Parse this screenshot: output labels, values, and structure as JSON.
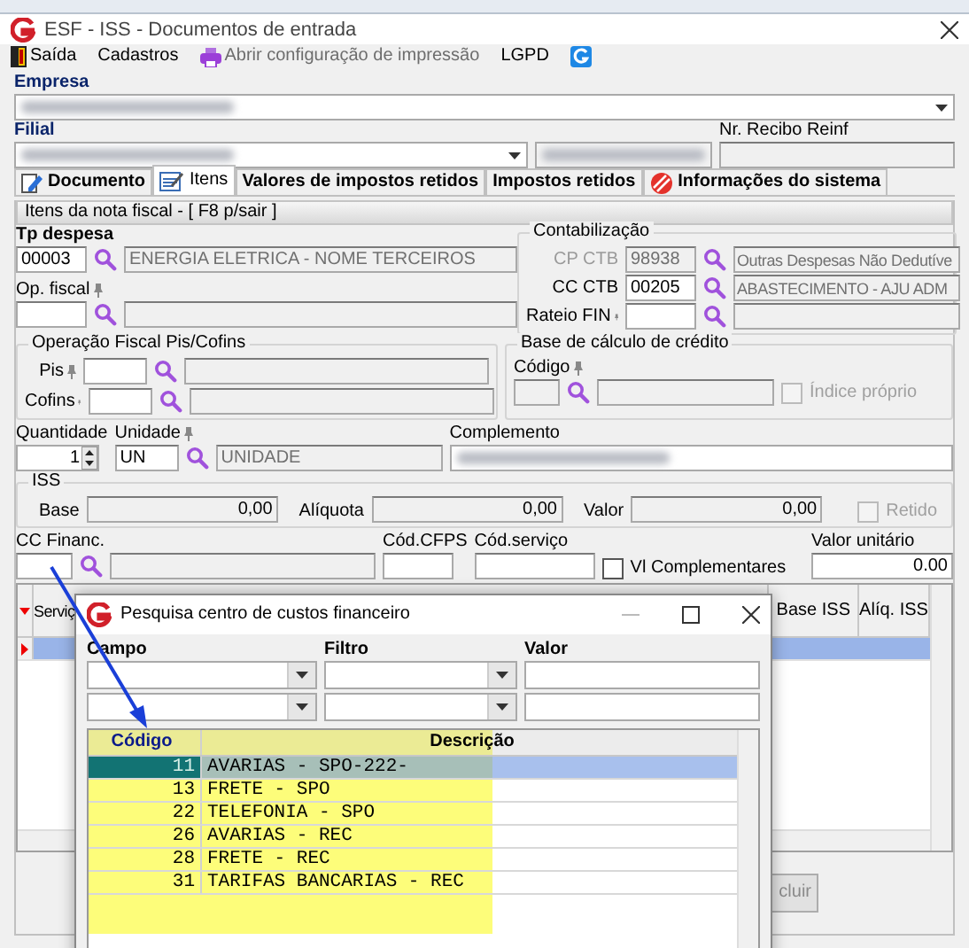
{
  "window": {
    "title": "ESF - ISS - Documentos de entrada"
  },
  "menu": [
    {
      "label": "Saída",
      "disabled": false
    },
    {
      "label": "Cadastros",
      "disabled": false
    },
    {
      "label": "Abrir configuração de impressão",
      "disabled": true
    },
    {
      "label": "LGPD",
      "disabled": false
    },
    {
      "disabled": false
    }
  ],
  "empresa": {
    "label": "Empresa",
    "redacted": true
  },
  "filial": {
    "label": "Filial",
    "redacted": true
  },
  "recibo_reinf": {
    "label": "Nr. Recibo Reinf"
  },
  "tabs": [
    {
      "label": "Documento",
      "selected": false
    },
    {
      "label": "Itens",
      "selected": true
    },
    {
      "label": "Valores de impostos retidos",
      "selected": false
    },
    {
      "label": "Impostos retidos",
      "selected": false
    },
    {
      "label": "Informações do sistema",
      "selected": false
    }
  ],
  "panel_title": "Itens da nota fiscal - [ F8 p/sair ]",
  "tp_despesa": {
    "label": "Tp despesa",
    "code": "00003",
    "description": "ENERGIA ELETRICA - NOME TERCEIROS"
  },
  "op_fiscal": {
    "label": "Op. fiscal"
  },
  "contabilizacao": {
    "title": "Contabilização",
    "rows": [
      {
        "label": "CP CTB",
        "code": "98938",
        "description": "Outras Despesas Não Dedutíve",
        "pin": false,
        "disabled": true
      },
      {
        "label": "CC CTB",
        "code": "00205",
        "description": "ABASTECIMENTO - AJU ADM",
        "pin": false,
        "disabled": false
      },
      {
        "label": "Rateio FIN",
        "pin": true,
        "disabled": false
      }
    ]
  },
  "pis_cofins": {
    "title": "Operação Fiscal Pis/Cofins",
    "rows": [
      {
        "label": "Pis"
      },
      {
        "label": "Cofins"
      }
    ]
  },
  "base_credito": {
    "title": "Base de cálculo de crédito",
    "label": "Código",
    "checkbox": {
      "label": "Índice próprio",
      "checked": false,
      "disabled": true
    }
  },
  "quantidade": {
    "label": "Quantidade",
    "value": "1"
  },
  "unidade": {
    "label": "Unidade",
    "code": "UN",
    "description": "UNIDADE"
  },
  "complemento": {
    "label": "Complemento",
    "redacted": true
  },
  "iss": {
    "title": "ISS",
    "fields": [
      {
        "label": "Base",
        "value": "0,00"
      },
      {
        "label": "Alíquota",
        "value": "0,00"
      },
      {
        "label": "Valor",
        "value": "0,00"
      }
    ],
    "retido": {
      "label": "Retido",
      "checked": false,
      "disabled": true
    }
  },
  "cc_financ": {
    "label": "CC Financ."
  },
  "cod_cfps": {
    "label": "Cód.CFPS"
  },
  "cod_servico": {
    "label": "Cód.serviço"
  },
  "vl_complementares": {
    "label": "Vl Complementares",
    "checked": false,
    "disabled": false
  },
  "valor_unitario": {
    "label": "Valor unitário",
    "value": "0.00"
  },
  "grid": {
    "columns": [
      "Serviç",
      "Base ISS",
      "Alíq. ISS"
    ],
    "rows": [
      {
        "selected": true
      }
    ]
  },
  "footer_button": {
    "label": "cluir"
  },
  "dialog": {
    "title": "Pesquisa centro de custos financeiro",
    "filter_labels": [
      "Campo",
      "Filtro",
      "Valor"
    ],
    "columns": [
      "Código",
      "Descrição"
    ],
    "rows": [
      {
        "code": "11",
        "description": "AVARIAS - SPO-222-",
        "selected": true
      },
      {
        "code": "13",
        "description": "FRETE - SPO",
        "selected": false
      },
      {
        "code": "22",
        "description": "TELEFONIA - SPO",
        "selected": false
      },
      {
        "code": "26",
        "description": "AVARIAS - REC",
        "selected": false
      },
      {
        "code": "28",
        "description": "FRETE - REC",
        "selected": false
      },
      {
        "code": "31",
        "description": "TARIFAS BANCARIAS - REC",
        "selected": false
      }
    ]
  },
  "annotations": {
    "highlight": true,
    "arrow": true
  }
}
